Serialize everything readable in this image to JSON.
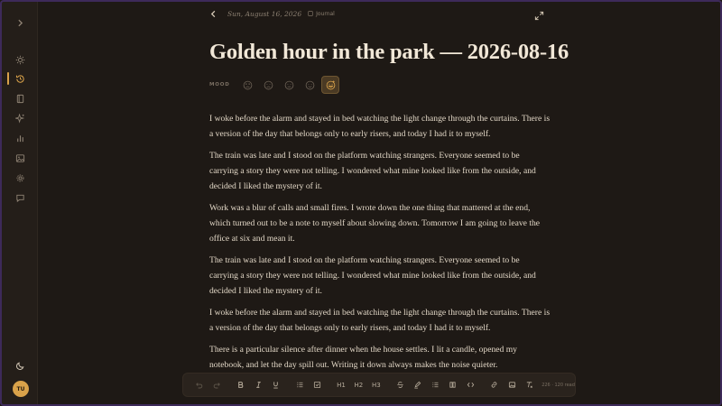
{
  "header": {
    "date": "Sun, August 16, 2026",
    "tag": "Journal"
  },
  "entry": {
    "title": "Golden hour in the park — 2026-08-16",
    "mood_label": "MOOD",
    "mood_selected": 4,
    "paragraphs": [
      "I woke before the alarm and stayed in bed watching the light change through the curtains. There is a version of the day that belongs only to early risers, and today I had it to myself.",
      "The train was late and I stood on the platform watching strangers. Everyone seemed to be carrying a story they were not telling. I wondered what mine looked like from the outside, and decided I liked the mystery of it.",
      "Work was a blur of calls and small fires. I wrote down the one thing that mattered at the end, which turned out to be a note to myself about slowing down. Tomorrow I am going to leave the office at six and mean it.",
      "The train was late and I stood on the platform watching strangers. Everyone seemed to be carrying a story they were not telling. I wondered what mine looked like from the outside, and decided I liked the mystery of it.",
      "I woke before the alarm and stayed in bed watching the light change through the curtains. There is a version of the day that belongs only to early risers, and today I had it to myself.",
      "There is a particular silence after dinner when the house settles. I lit a candle, opened my notebook, and let the day spill out. Writing it down always makes the noise quieter."
    ]
  },
  "sidebar": {
    "avatar_initials": "TU",
    "items": [
      "sun-icon",
      "history-icon",
      "book-icon",
      "sparkle-icon",
      "bar-chart-icon",
      "image-icon",
      "gear-icon",
      "chat-icon"
    ]
  },
  "toolbar": {
    "h1": "H1",
    "h2": "H2",
    "h3": "H3",
    "word_count": "226 · 120 read"
  },
  "colors": {
    "accent": "#d9a24a",
    "background": "#1e1915",
    "sidebar": "#241e19",
    "text": "#e3d8c7"
  }
}
